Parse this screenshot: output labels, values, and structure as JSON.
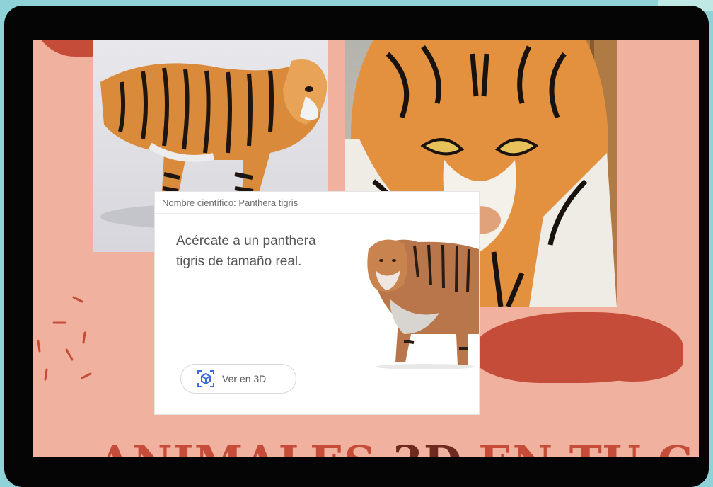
{
  "card": {
    "caption": "Nombre científico: Panthera tigris",
    "description": "Acércate a un panthera tigris de tamaño real.",
    "view_3d_label": "Ver en 3D"
  },
  "headline": {
    "part1": "ANIMALES",
    "part2": "3D",
    "part3": "EN TU CASA"
  },
  "colors": {
    "background": "#8fd3d8",
    "screen": "#f0b29e",
    "accent": "#c64c3a",
    "accent_dark": "#6e2a1f"
  },
  "icons": {
    "view_3d": "ar-cube-icon"
  }
}
